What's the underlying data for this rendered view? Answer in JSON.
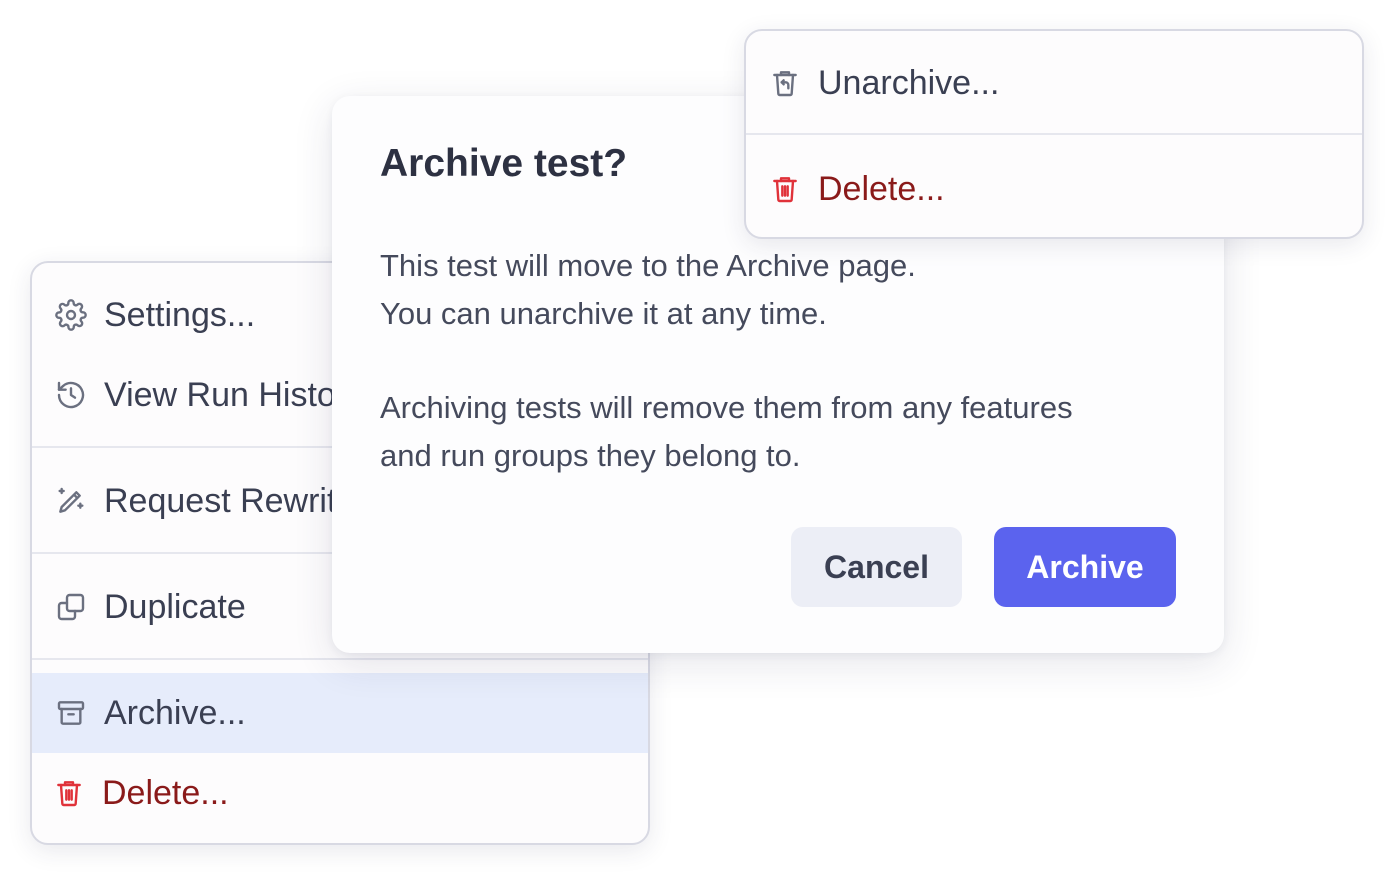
{
  "left_menu": {
    "items": [
      {
        "label": "Settings...",
        "icon": "gear-icon"
      },
      {
        "label": "View Run History",
        "icon": "history-icon"
      },
      {
        "label": "Request Rewrite",
        "icon": "pencil-sparkle-icon"
      },
      {
        "label": "Duplicate",
        "icon": "duplicate-icon"
      },
      {
        "label": "Archive...",
        "icon": "archive-box-icon",
        "selected": true
      },
      {
        "label": "Delete...",
        "icon": "trash-icon",
        "danger": true
      }
    ]
  },
  "right_menu": {
    "items": [
      {
        "label": "Unarchive...",
        "icon": "trash-restore-icon"
      },
      {
        "label": "Delete...",
        "icon": "trash-icon",
        "danger": true
      }
    ]
  },
  "dialog": {
    "title": "Archive test?",
    "line1": "This test will move to the Archive page.",
    "line2": "You can unarchive it at any time.",
    "line3": "Archiving tests will remove them from any features",
    "line4": "and run groups they belong to.",
    "cancel_label": "Cancel",
    "confirm_label": "Archive"
  },
  "colors": {
    "accent": "#5b63ee",
    "danger_text": "#8a1a1a",
    "danger_icon": "#e0323a",
    "selected_row": "#e6ecfb"
  }
}
